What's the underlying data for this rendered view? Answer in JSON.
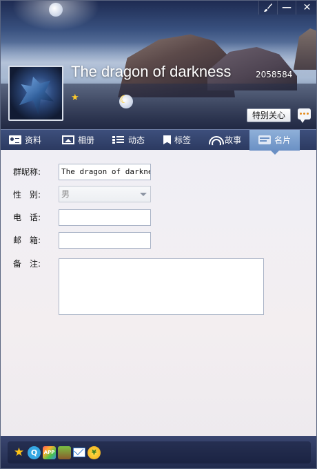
{
  "header": {
    "nickname": "The dragon of darkness",
    "qq_number": "2058584",
    "special_care_label": "特别关心",
    "window_controls": {
      "skin_icon": "brush-icon",
      "minimize_label": "—",
      "close_label": "✕"
    },
    "level_icons": [
      "moon-icon",
      "star-icon"
    ]
  },
  "tabs": [
    {
      "label": "资料",
      "icon": "profile-card-icon",
      "active": false
    },
    {
      "label": "相册",
      "icon": "photo-album-icon",
      "active": false
    },
    {
      "label": "动态",
      "icon": "feed-list-icon",
      "active": false
    },
    {
      "label": "标签",
      "icon": "tag-icon",
      "active": false
    },
    {
      "label": "故事",
      "icon": "story-rainbow-icon",
      "active": false
    },
    {
      "label": "名片",
      "icon": "name-card-icon",
      "active": true
    }
  ],
  "form": {
    "group_nickname": {
      "label": "群昵称:",
      "value": "The dragon of darknes"
    },
    "gender": {
      "label": "性　别:",
      "value": "男"
    },
    "phone": {
      "label": "电　话:",
      "value": ""
    },
    "email": {
      "label": "邮　箱:",
      "value": ""
    },
    "note": {
      "label": "备　注:",
      "value": ""
    }
  },
  "bottom_bar": {
    "icons": [
      "favorite-star-icon",
      "qzone-icon",
      "app-icon",
      "game-icon",
      "mail-icon",
      "payment-icon"
    ],
    "qzone_glyph": "Q",
    "app_glyph": "APP",
    "pay_glyph": "¥"
  }
}
